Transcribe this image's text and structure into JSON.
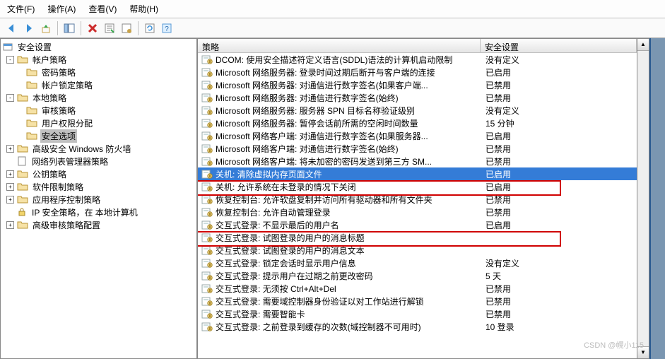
{
  "menu": {
    "file": "文件(F)",
    "action": "操作(A)",
    "view": "查看(V)",
    "help": "帮助(H)"
  },
  "tree": {
    "root": "安全设置",
    "account": "帐户策略",
    "password": "密码策略",
    "lockout": "帐户锁定策略",
    "local": "本地策略",
    "audit": "审核策略",
    "rights": "用户权限分配",
    "options": "安全选项",
    "wfas": "高级安全 Windows 防火墙",
    "nlm": "网络列表管理器策略",
    "pubkey": "公钥策略",
    "swrestrict": "软件限制策略",
    "appctrl": "应用程序控制策略",
    "ipsec": "IP 安全策略，在 本地计算机",
    "advaudit": "高级审核策略配置"
  },
  "cols": {
    "policy": "策略",
    "setting": "安全设置"
  },
  "rows": [
    {
      "p": "DCOM: 使用安全描述符定义语言(SDDL)语法的计算机启动限制",
      "s": "没有定义"
    },
    {
      "p": "Microsoft 网络服务器: 登录时间过期后断开与客户端的连接",
      "s": "已启用"
    },
    {
      "p": "Microsoft 网络服务器: 对通信进行数字签名(如果客户端...",
      "s": "已禁用"
    },
    {
      "p": "Microsoft 网络服务器: 对通信进行数字签名(始终)",
      "s": "已禁用"
    },
    {
      "p": "Microsoft 网络服务器: 服务器 SPN 目标名称验证级别",
      "s": "没有定义"
    },
    {
      "p": "Microsoft 网络服务器: 暂停会话前所需的空闲时间数量",
      "s": "15 分钟"
    },
    {
      "p": "Microsoft 网络客户端: 对通信进行数字签名(如果服务器...",
      "s": "已启用"
    },
    {
      "p": "Microsoft 网络客户端: 对通信进行数字签名(始终)",
      "s": "已禁用"
    },
    {
      "p": "Microsoft 网络客户端: 将未加密的密码发送到第三方 SM...",
      "s": "已禁用"
    },
    {
      "p": "关机: 清除虚拟内存页面文件",
      "s": "已启用"
    },
    {
      "p": "关机: 允许系统在未登录的情况下关闭",
      "s": "已启用"
    },
    {
      "p": "恢复控制台: 允许软盘复制并访问所有驱动器和所有文件夹",
      "s": "已禁用"
    },
    {
      "p": "恢复控制台: 允许自动管理登录",
      "s": "已禁用"
    },
    {
      "p": "交互式登录: 不显示最后的用户名",
      "s": "已启用"
    },
    {
      "p": "交互式登录: 试图登录的用户的消息标题",
      "s": ""
    },
    {
      "p": "交互式登录: 试图登录的用户的消息文本",
      "s": ""
    },
    {
      "p": "交互式登录: 锁定会话时显示用户信息",
      "s": "没有定义"
    },
    {
      "p": "交互式登录: 提示用户在过期之前更改密码",
      "s": "5 天"
    },
    {
      "p": "交互式登录: 无须按  Ctrl+Alt+Del",
      "s": "已禁用"
    },
    {
      "p": "交互式登录: 需要域控制器身份验证以对工作站进行解锁",
      "s": "已禁用"
    },
    {
      "p": "交互式登录: 需要智能卡",
      "s": "已禁用"
    },
    {
      "p": "交互式登录: 之前登录到缓存的次数(域控制器不可用时)",
      "s": "10 登录"
    }
  ],
  "watermark": "CSDN @幌小115"
}
